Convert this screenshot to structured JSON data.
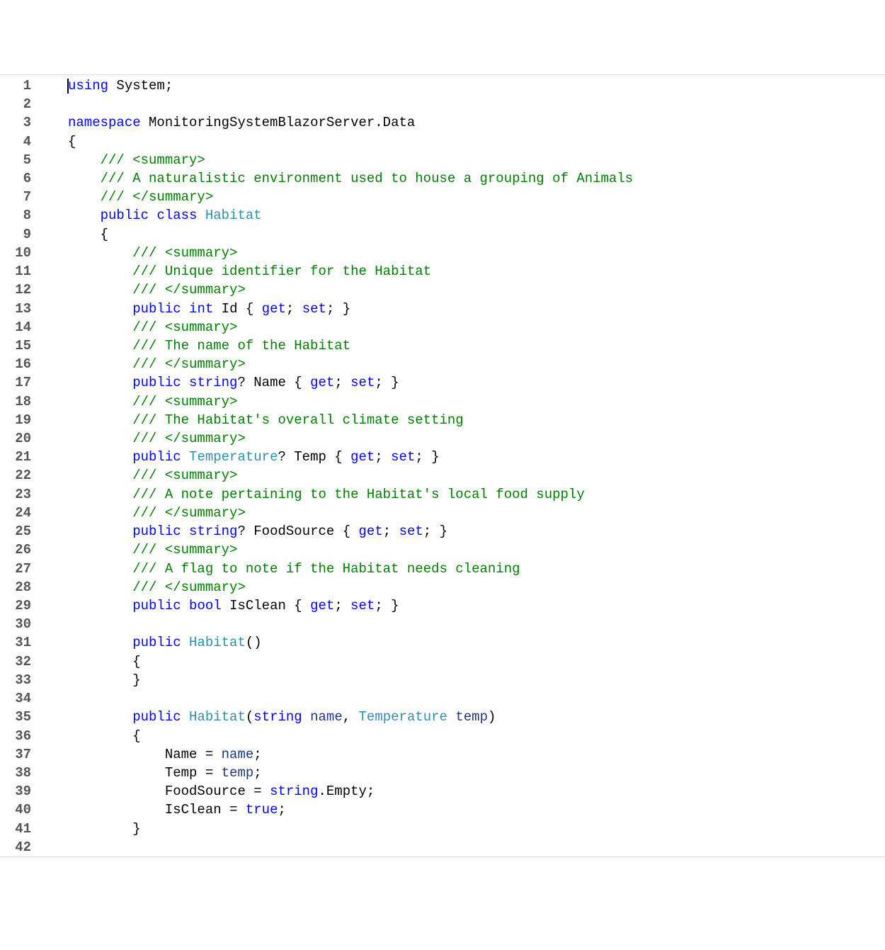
{
  "lineCount": 42,
  "lines": [
    {
      "indent": 0,
      "cursor": true,
      "tokens": [
        [
          "kw",
          "using"
        ],
        [
          "",
          null
        ],
        [
          "id",
          "System"
        ],
        [
          "punc",
          ";"
        ]
      ]
    },
    {
      "indent": 0,
      "tokens": []
    },
    {
      "indent": 0,
      "tokens": [
        [
          "kw",
          "namespace"
        ],
        [
          "",
          null
        ],
        [
          "id",
          "MonitoringSystemBlazorServer.Data"
        ]
      ]
    },
    {
      "indent": 0,
      "tokens": [
        [
          "punc",
          "{"
        ]
      ]
    },
    {
      "indent": 1,
      "tokens": [
        [
          "com",
          "/// <summary>"
        ]
      ]
    },
    {
      "indent": 1,
      "tokens": [
        [
          "com",
          "/// A naturalistic environment used to house a grouping of Animals"
        ]
      ]
    },
    {
      "indent": 1,
      "tokens": [
        [
          "com",
          "/// </summary>"
        ]
      ]
    },
    {
      "indent": 1,
      "tokens": [
        [
          "kw",
          "public"
        ],
        [
          "",
          null
        ],
        [
          "kw",
          "class"
        ],
        [
          "",
          null
        ],
        [
          "type",
          "Habitat"
        ]
      ]
    },
    {
      "indent": 1,
      "tokens": [
        [
          "punc",
          "{"
        ]
      ]
    },
    {
      "indent": 2,
      "tokens": [
        [
          "com",
          "/// <summary>"
        ]
      ]
    },
    {
      "indent": 2,
      "tokens": [
        [
          "com",
          "/// Unique identifier for the Habitat"
        ]
      ]
    },
    {
      "indent": 2,
      "tokens": [
        [
          "com",
          "/// </summary>"
        ]
      ]
    },
    {
      "indent": 2,
      "tokens": [
        [
          "kw",
          "public"
        ],
        [
          "",
          null
        ],
        [
          "kw",
          "int"
        ],
        [
          "",
          null
        ],
        [
          "id",
          "Id"
        ],
        [
          "",
          null
        ],
        [
          "punc",
          "{"
        ],
        [
          "",
          null
        ],
        [
          "kw",
          "get"
        ],
        [
          "punc",
          ";"
        ],
        [
          "",
          null
        ],
        [
          "kw",
          "set"
        ],
        [
          "punc",
          ";"
        ],
        [
          "",
          null
        ],
        [
          "punc",
          "}"
        ]
      ]
    },
    {
      "indent": 2,
      "tokens": [
        [
          "com",
          "/// <summary>"
        ]
      ]
    },
    {
      "indent": 2,
      "tokens": [
        [
          "com",
          "/// The name of the Habitat"
        ]
      ]
    },
    {
      "indent": 2,
      "tokens": [
        [
          "com",
          "/// </summary>"
        ]
      ]
    },
    {
      "indent": 2,
      "tokens": [
        [
          "kw",
          "public"
        ],
        [
          "",
          null
        ],
        [
          "kw",
          "string"
        ],
        [
          "punc",
          "?"
        ],
        [
          "",
          null
        ],
        [
          "id",
          "Name"
        ],
        [
          "",
          null
        ],
        [
          "punc",
          "{"
        ],
        [
          "",
          null
        ],
        [
          "kw",
          "get"
        ],
        [
          "punc",
          ";"
        ],
        [
          "",
          null
        ],
        [
          "kw",
          "set"
        ],
        [
          "punc",
          ";"
        ],
        [
          "",
          null
        ],
        [
          "punc",
          "}"
        ]
      ]
    },
    {
      "indent": 2,
      "tokens": [
        [
          "com",
          "/// <summary>"
        ]
      ]
    },
    {
      "indent": 2,
      "tokens": [
        [
          "com",
          "/// The Habitat's overall climate setting"
        ]
      ]
    },
    {
      "indent": 2,
      "tokens": [
        [
          "com",
          "/// </summary>"
        ]
      ]
    },
    {
      "indent": 2,
      "tokens": [
        [
          "kw",
          "public"
        ],
        [
          "",
          null
        ],
        [
          "type",
          "Temperature"
        ],
        [
          "punc",
          "?"
        ],
        [
          "",
          null
        ],
        [
          "id",
          "Temp"
        ],
        [
          "",
          null
        ],
        [
          "punc",
          "{"
        ],
        [
          "",
          null
        ],
        [
          "kw",
          "get"
        ],
        [
          "punc",
          ";"
        ],
        [
          "",
          null
        ],
        [
          "kw",
          "set"
        ],
        [
          "punc",
          ";"
        ],
        [
          "",
          null
        ],
        [
          "punc",
          "}"
        ]
      ]
    },
    {
      "indent": 2,
      "tokens": [
        [
          "com",
          "/// <summary>"
        ]
      ]
    },
    {
      "indent": 2,
      "tokens": [
        [
          "com",
          "/// A note pertaining to the Habitat's local food supply"
        ]
      ]
    },
    {
      "indent": 2,
      "tokens": [
        [
          "com",
          "/// </summary>"
        ]
      ]
    },
    {
      "indent": 2,
      "tokens": [
        [
          "kw",
          "public"
        ],
        [
          "",
          null
        ],
        [
          "kw",
          "string"
        ],
        [
          "punc",
          "?"
        ],
        [
          "",
          null
        ],
        [
          "id",
          "FoodSource"
        ],
        [
          "",
          null
        ],
        [
          "punc",
          "{"
        ],
        [
          "",
          null
        ],
        [
          "kw",
          "get"
        ],
        [
          "punc",
          ";"
        ],
        [
          "",
          null
        ],
        [
          "kw",
          "set"
        ],
        [
          "punc",
          ";"
        ],
        [
          "",
          null
        ],
        [
          "punc",
          "}"
        ]
      ]
    },
    {
      "indent": 2,
      "tokens": [
        [
          "com",
          "/// <summary>"
        ]
      ]
    },
    {
      "indent": 2,
      "tokens": [
        [
          "com",
          "/// A flag to note if the Habitat needs cleaning"
        ]
      ]
    },
    {
      "indent": 2,
      "tokens": [
        [
          "com",
          "/// </summary>"
        ]
      ]
    },
    {
      "indent": 2,
      "tokens": [
        [
          "kw",
          "public"
        ],
        [
          "",
          null
        ],
        [
          "kw",
          "bool"
        ],
        [
          "",
          null
        ],
        [
          "id",
          "IsClean"
        ],
        [
          "",
          null
        ],
        [
          "punc",
          "{"
        ],
        [
          "",
          null
        ],
        [
          "kw",
          "get"
        ],
        [
          "punc",
          ";"
        ],
        [
          "",
          null
        ],
        [
          "kw",
          "set"
        ],
        [
          "punc",
          ";"
        ],
        [
          "",
          null
        ],
        [
          "punc",
          "}"
        ]
      ]
    },
    {
      "indent": 2,
      "tokens": []
    },
    {
      "indent": 2,
      "tokens": [
        [
          "kw",
          "public"
        ],
        [
          "",
          null
        ],
        [
          "type",
          "Habitat"
        ],
        [
          "punc",
          "()"
        ]
      ]
    },
    {
      "indent": 2,
      "tokens": [
        [
          "punc",
          "{"
        ]
      ]
    },
    {
      "indent": 2,
      "tokens": [
        [
          "punc",
          "}"
        ]
      ]
    },
    {
      "indent": 2,
      "tokens": []
    },
    {
      "indent": 2,
      "tokens": [
        [
          "kw",
          "public"
        ],
        [
          "",
          null
        ],
        [
          "type",
          "Habitat"
        ],
        [
          "punc",
          "("
        ],
        [
          "kw",
          "string"
        ],
        [
          "",
          null
        ],
        [
          "param",
          "name"
        ],
        [
          "punc",
          ","
        ],
        [
          "",
          null
        ],
        [
          "type",
          "Temperature"
        ],
        [
          "",
          null
        ],
        [
          "param",
          "temp"
        ],
        [
          "punc",
          ")"
        ]
      ]
    },
    {
      "indent": 2,
      "tokens": [
        [
          "punc",
          "{"
        ]
      ]
    },
    {
      "indent": 3,
      "tokens": [
        [
          "id",
          "Name"
        ],
        [
          "",
          null
        ],
        [
          "punc",
          "="
        ],
        [
          "",
          null
        ],
        [
          "param",
          "name"
        ],
        [
          "punc",
          ";"
        ]
      ]
    },
    {
      "indent": 3,
      "tokens": [
        [
          "id",
          "Temp"
        ],
        [
          "",
          null
        ],
        [
          "punc",
          "="
        ],
        [
          "",
          null
        ],
        [
          "param",
          "temp"
        ],
        [
          "punc",
          ";"
        ]
      ]
    },
    {
      "indent": 3,
      "tokens": [
        [
          "id",
          "FoodSource"
        ],
        [
          "",
          null
        ],
        [
          "punc",
          "="
        ],
        [
          "",
          null
        ],
        [
          "kw",
          "string"
        ],
        [
          "punc",
          "."
        ],
        [
          "id",
          "Empty"
        ],
        [
          "punc",
          ";"
        ]
      ]
    },
    {
      "indent": 3,
      "tokens": [
        [
          "id",
          "IsClean"
        ],
        [
          "",
          null
        ],
        [
          "punc",
          "="
        ],
        [
          "",
          null
        ],
        [
          "kw",
          "true"
        ],
        [
          "punc",
          ";"
        ]
      ]
    },
    {
      "indent": 2,
      "tokens": [
        [
          "punc",
          "}"
        ]
      ]
    },
    {
      "indent": 2,
      "tokens": []
    }
  ]
}
